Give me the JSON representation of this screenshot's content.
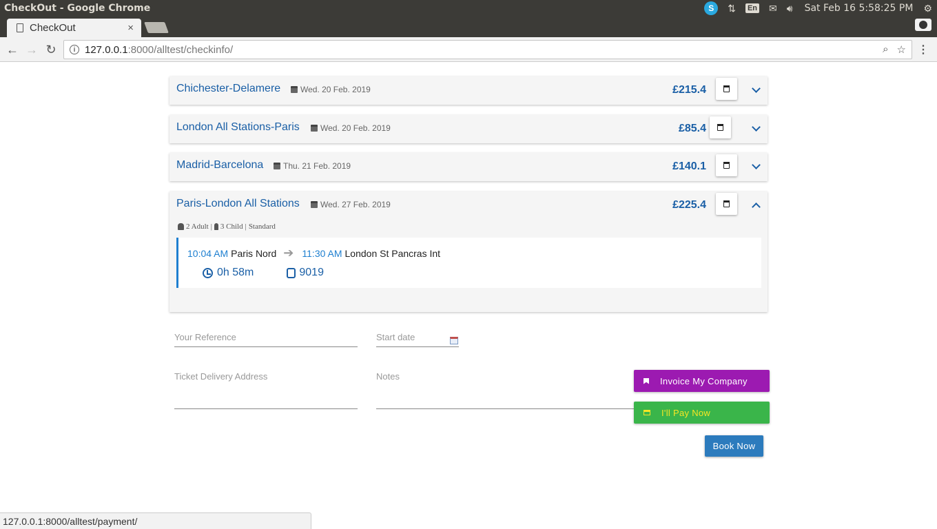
{
  "os": {
    "window_title": "CheckOut - Google Chrome",
    "keyboard_layout": "En",
    "clock": "Sat Feb 16  5:58:25 PM"
  },
  "browser": {
    "tab_title": "CheckOut",
    "tab_close": "×",
    "url_host": "127.0.0.1",
    "url_path": ":8000/alltest/checkinfo/",
    "status_url": "127.0.0.1:8000/alltest/payment/"
  },
  "trips": [
    {
      "title": "Chichester-Delamere",
      "date": "Wed. 20 Feb. 2019",
      "price": "£215.4",
      "expanded": false
    },
    {
      "title": "London All Stations-Paris",
      "date": "Wed. 20 Feb. 2019",
      "price": "£85.4",
      "expanded": false
    },
    {
      "title": "Madrid-Barcelona",
      "date": "Thu. 21 Feb. 2019",
      "price": "£140.1",
      "expanded": false
    },
    {
      "title": "Paris-London All Stations",
      "date": "Wed. 27 Feb. 2019",
      "price": "£225.4",
      "expanded": true,
      "passengers": {
        "adult": "2 Adult",
        "child": "3 Child",
        "class": "Standard"
      },
      "leg": {
        "depart_time": "10:04 AM",
        "depart_station": "Paris Nord",
        "arrive_time": "11:30 AM",
        "arrive_station": "London St Pancras Int",
        "duration": "0h 58m",
        "train_number": "9019"
      }
    }
  ],
  "form": {
    "reference_label": "Your Reference",
    "start_date_label": "Start date",
    "address_label": "Ticket Delivery Address",
    "notes_label": "Notes"
  },
  "actions": {
    "invoice_label": "Invoice My Company",
    "pay_label": "I'll Pay Now",
    "book_label": "Book Now"
  },
  "colors": {
    "link_blue": "#1a5fa6",
    "invoice_purple": "#9c1ab1",
    "pay_green": "#3ab54a",
    "book_blue": "#2c7bbd"
  }
}
